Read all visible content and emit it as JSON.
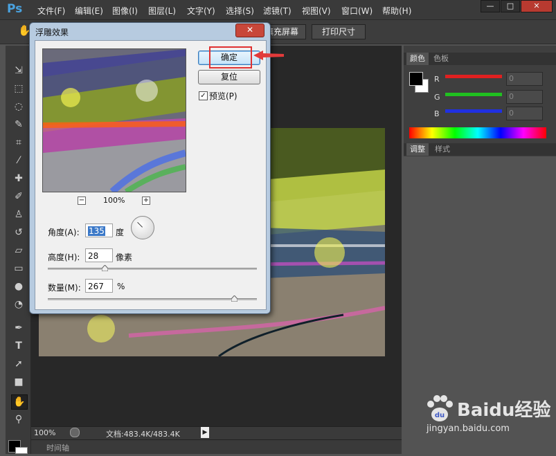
{
  "app": {
    "logo": "Ps"
  },
  "menu": [
    "文件(F)",
    "编辑(E)",
    "图像(I)",
    "图层(L)",
    "文字(Y)",
    "选择(S)",
    "滤镜(T)",
    "视图(V)",
    "窗口(W)",
    "帮助(H)"
  ],
  "window_controls": {
    "minimize": "—",
    "restore": "□",
    "close": "✕"
  },
  "options_bar": {
    "fill_screen": "填充屏幕",
    "print_size": "打印尺寸"
  },
  "status": {
    "zoom": "100%",
    "doc_info": "文档:483.4K/483.4K"
  },
  "timeline": {
    "label": "时间轴"
  },
  "panels": {
    "color_tabs": [
      "颜色",
      "色板"
    ],
    "adjust_tabs": [
      "调整",
      "样式"
    ],
    "channels": [
      {
        "label": "R",
        "value": "0",
        "color": "#e02020"
      },
      {
        "label": "G",
        "value": "0",
        "color": "#20c020"
      },
      {
        "label": "B",
        "value": "0",
        "color": "#2030e0"
      }
    ]
  },
  "dialog": {
    "title": "浮雕效果",
    "close": "✕",
    "ok": "确定",
    "reset": "复位",
    "preview_label": "预览(P)",
    "preview_checked": true,
    "zoom": "100%",
    "zoom_minus": "−",
    "zoom_plus": "+",
    "angle_label": "角度(A):",
    "angle_value": "135",
    "angle_unit": "度",
    "height_label": "高度(H):",
    "height_value": "28",
    "height_unit": "像素",
    "height_slider_fraction": 0.27,
    "amount_label": "数量(M):",
    "amount_value": "267",
    "amount_unit": "%",
    "amount_slider_fraction": 0.89
  },
  "watermark": {
    "brand": "Baidu经验",
    "url": "jingyan.baidu.com"
  }
}
